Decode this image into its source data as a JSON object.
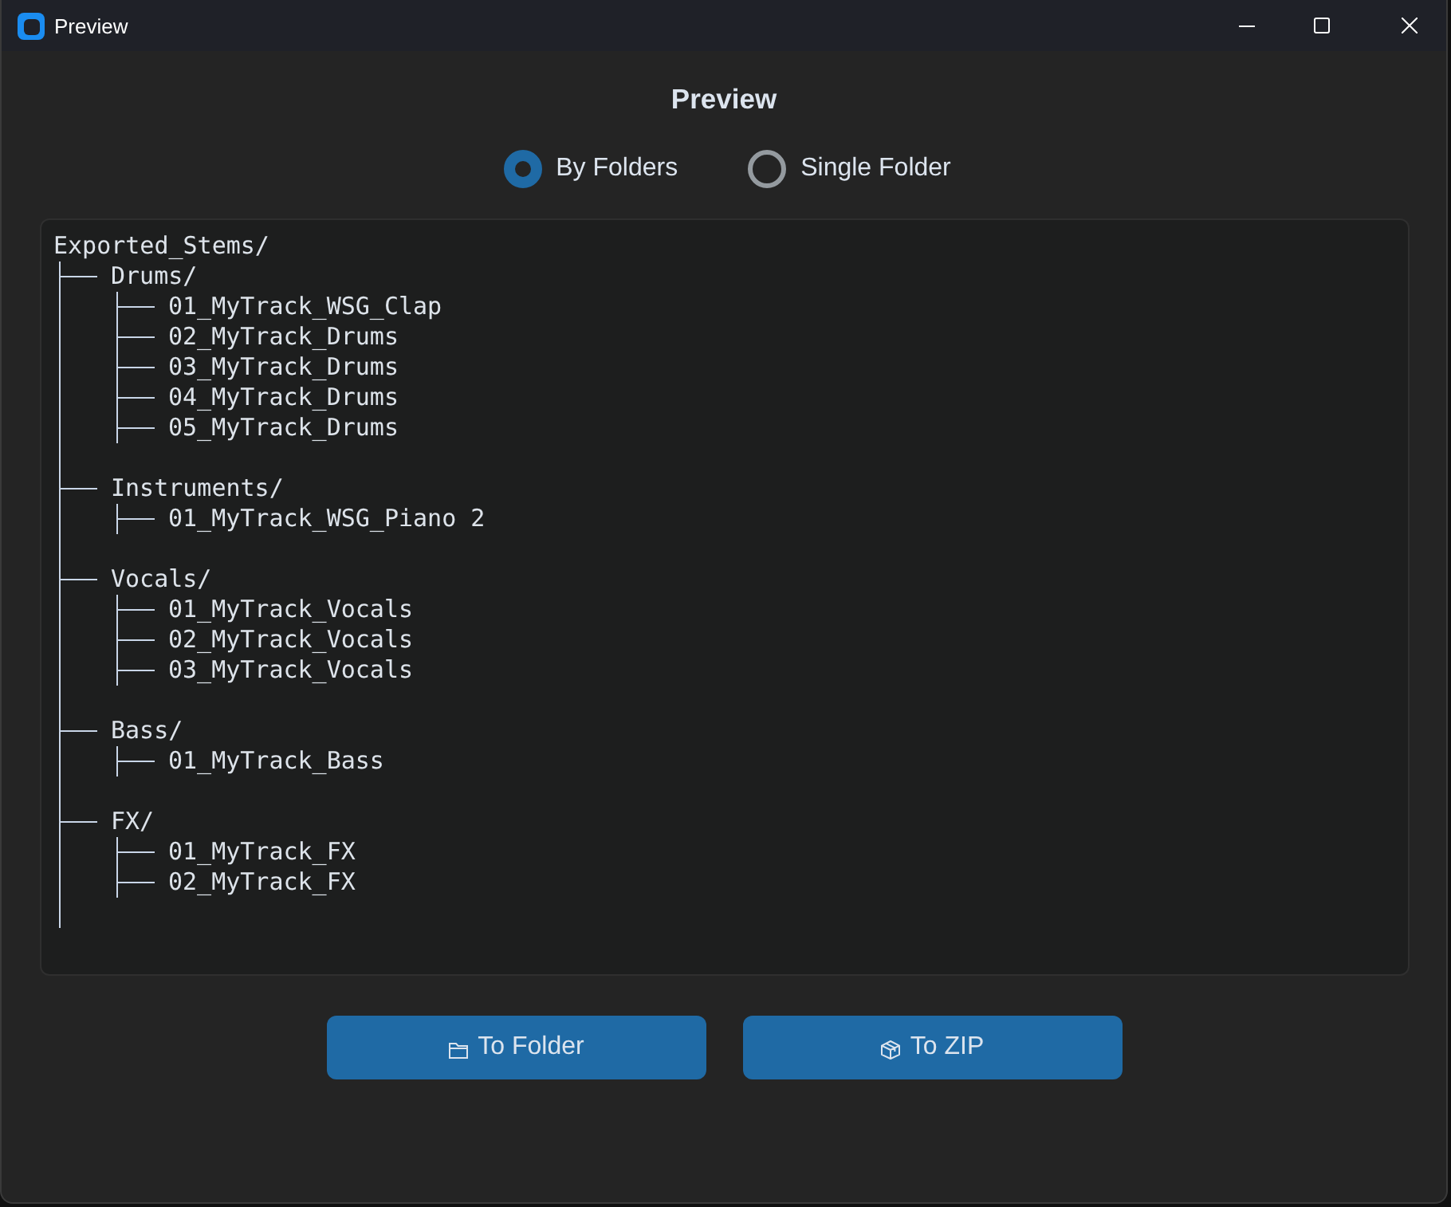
{
  "window": {
    "title": "Preview"
  },
  "heading": "Preview",
  "layout_options": [
    {
      "label": "By Folders",
      "selected": true
    },
    {
      "label": "Single Folder",
      "selected": false
    }
  ],
  "tree": {
    "name": "Exported_Stems/",
    "children": [
      {
        "name": "Drums/",
        "children": [
          {
            "name": "01_MyTrack_WSG_Clap"
          },
          {
            "name": "02_MyTrack_Drums"
          },
          {
            "name": "03_MyTrack_Drums"
          },
          {
            "name": "04_MyTrack_Drums"
          },
          {
            "name": "05_MyTrack_Drums"
          }
        ]
      },
      {
        "name": "Instruments/",
        "children": [
          {
            "name": "01_MyTrack_WSG_Piano 2"
          }
        ]
      },
      {
        "name": "Vocals/",
        "children": [
          {
            "name": "01_MyTrack_Vocals"
          },
          {
            "name": "02_MyTrack_Vocals"
          },
          {
            "name": "03_MyTrack_Vocals"
          }
        ]
      },
      {
        "name": "Bass/",
        "children": [
          {
            "name": "01_MyTrack_Bass"
          }
        ]
      },
      {
        "name": "FX/",
        "children": [
          {
            "name": "01_MyTrack_FX"
          },
          {
            "name": "02_MyTrack_FX"
          }
        ]
      }
    ]
  },
  "buttons": [
    {
      "label": "To Folder",
      "kind": "folder"
    },
    {
      "label": "To ZIP",
      "kind": "zip"
    }
  ]
}
